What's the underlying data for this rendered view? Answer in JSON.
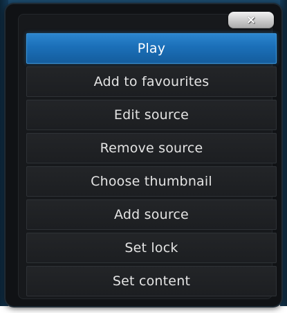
{
  "dialog": {
    "close_glyph": "×",
    "close_icon": "close-icon"
  },
  "menu": {
    "selected_index": 0,
    "items": [
      {
        "label": "Play"
      },
      {
        "label": "Add to favourites"
      },
      {
        "label": "Edit source"
      },
      {
        "label": "Remove source"
      },
      {
        "label": "Choose thumbnail"
      },
      {
        "label": "Add source"
      },
      {
        "label": "Set lock"
      },
      {
        "label": "Set content"
      }
    ]
  },
  "colors": {
    "selected_bg": "#1b6fb8",
    "item_bg": "#1f2124",
    "text": "#e4e4e4"
  }
}
